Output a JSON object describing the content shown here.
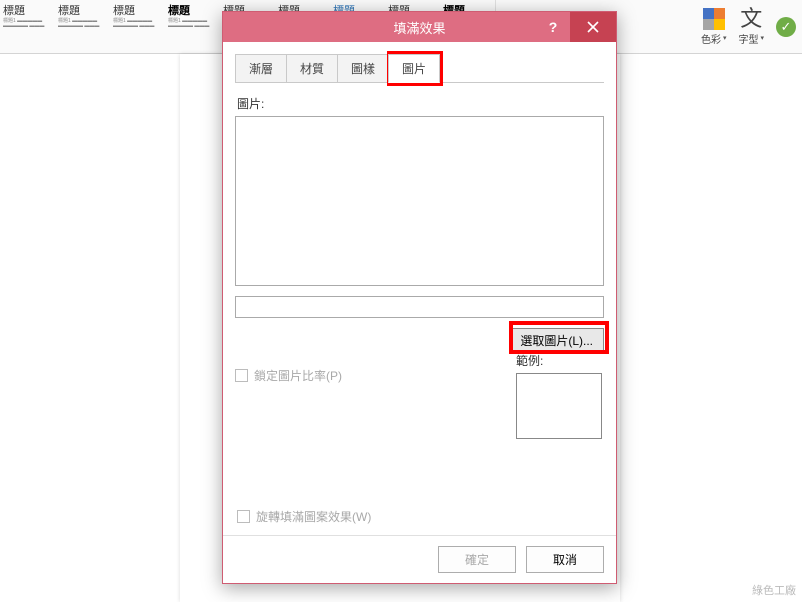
{
  "ribbon": {
    "styles": [
      {
        "title": "標題",
        "color": "plain"
      },
      {
        "title": "標題",
        "color": "plain"
      },
      {
        "title": "標題",
        "color": "plain"
      },
      {
        "title": "標題",
        "color": "bold"
      },
      {
        "title": "標題",
        "color": "plain"
      },
      {
        "title": "標題",
        "color": "plain"
      },
      {
        "title": "標題",
        "color": "blue"
      },
      {
        "title": "標題",
        "color": "plain"
      },
      {
        "title": "標題",
        "color": "bold"
      }
    ],
    "color_label": "色彩",
    "font_label": "字型"
  },
  "dialog": {
    "title": "填滿效果",
    "tabs": [
      "漸層",
      "材質",
      "圖樣",
      "圖片"
    ],
    "active_tab": 3,
    "picture_label": "圖片:",
    "select_button": "選取圖片(L)...",
    "lock_ratio": "鎖定圖片比率(P)",
    "rotate_fill": "旋轉填滿圖案效果(W)",
    "sample_label": "範例:",
    "ok": "確定",
    "cancel": "取消"
  },
  "watermark": "綠色工廠"
}
